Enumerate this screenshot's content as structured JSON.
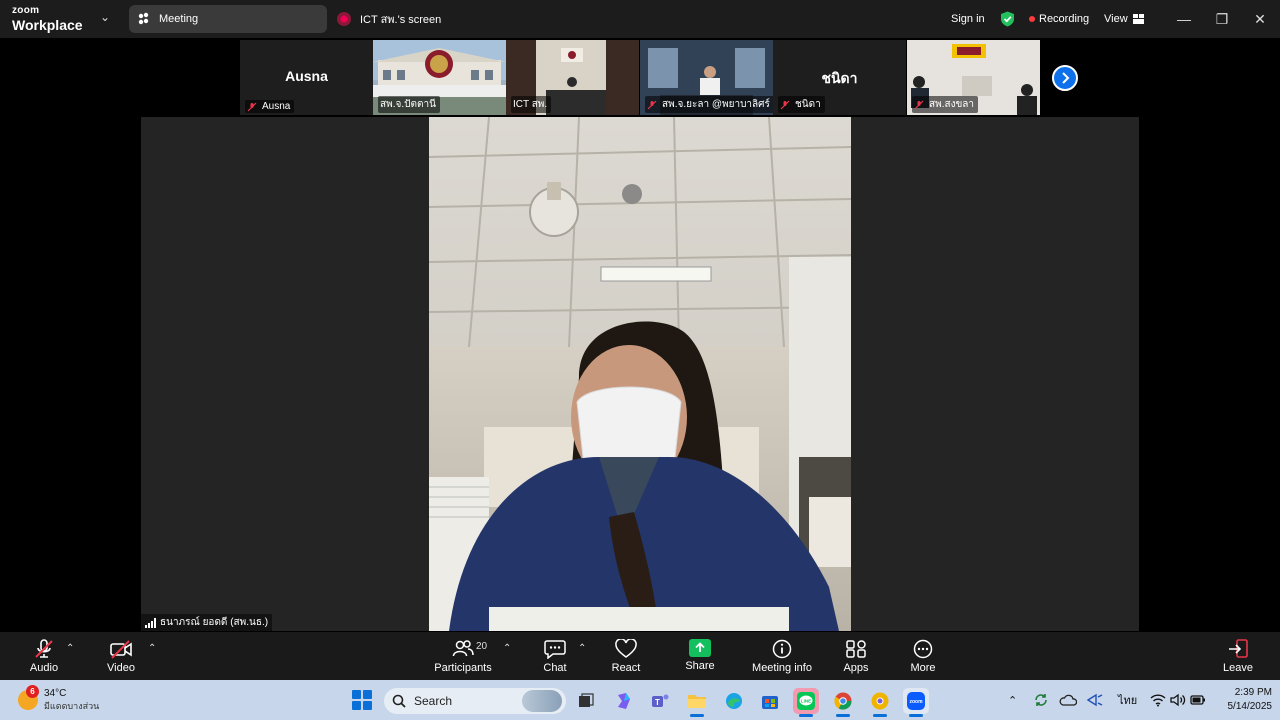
{
  "titlebar": {
    "brand_line1": "zoom",
    "brand_line2": "Workplace",
    "meeting_tab": "Meeting",
    "screen_tab": "ICT สพ.'s screen",
    "sign_in": "Sign in",
    "recording": "Recording",
    "view": "View"
  },
  "thumbnails": [
    {
      "big_name": "Ausna",
      "name": "Ausna",
      "muted": true,
      "kind": "name-card"
    },
    {
      "big_name": "",
      "name": "สพ.จ.ปัตตานี",
      "muted": false,
      "kind": "building"
    },
    {
      "big_name": "",
      "name": "ICT สพ.",
      "muted": false,
      "kind": "room"
    },
    {
      "big_name": "",
      "name": "สพ.จ.ยะลา @พยาบาลิศร์ ร้า...",
      "muted": true,
      "kind": "office"
    },
    {
      "big_name": "ชนิดา",
      "name": "ชนิดา",
      "muted": true,
      "kind": "name-card"
    },
    {
      "big_name": "",
      "name": "สพ.สงขลา",
      "muted": true,
      "kind": "office2"
    }
  ],
  "main_video": {
    "speaker_name": "ธนาภรณ์ ยอดดี (สพ.นธ.)"
  },
  "toolbar": {
    "audio": "Audio",
    "video": "Video",
    "participants": "Participants",
    "participants_count": "20",
    "chat": "Chat",
    "react": "React",
    "share": "Share",
    "meeting_info": "Meeting info",
    "apps": "Apps",
    "more": "More",
    "leave": "Leave"
  },
  "taskbar": {
    "weather_temp": "34°C",
    "weather_desc": "มีแดดบางส่วน",
    "weather_badge": "6",
    "search": "Search",
    "language": "ไทย",
    "time": "2:39 PM",
    "date": "5/14/2025"
  },
  "colors": {
    "accent_blue": "#0e71eb",
    "share_green": "#13c05d",
    "recording_red": "#ff3b3b",
    "mute_red": "#e8364a"
  }
}
